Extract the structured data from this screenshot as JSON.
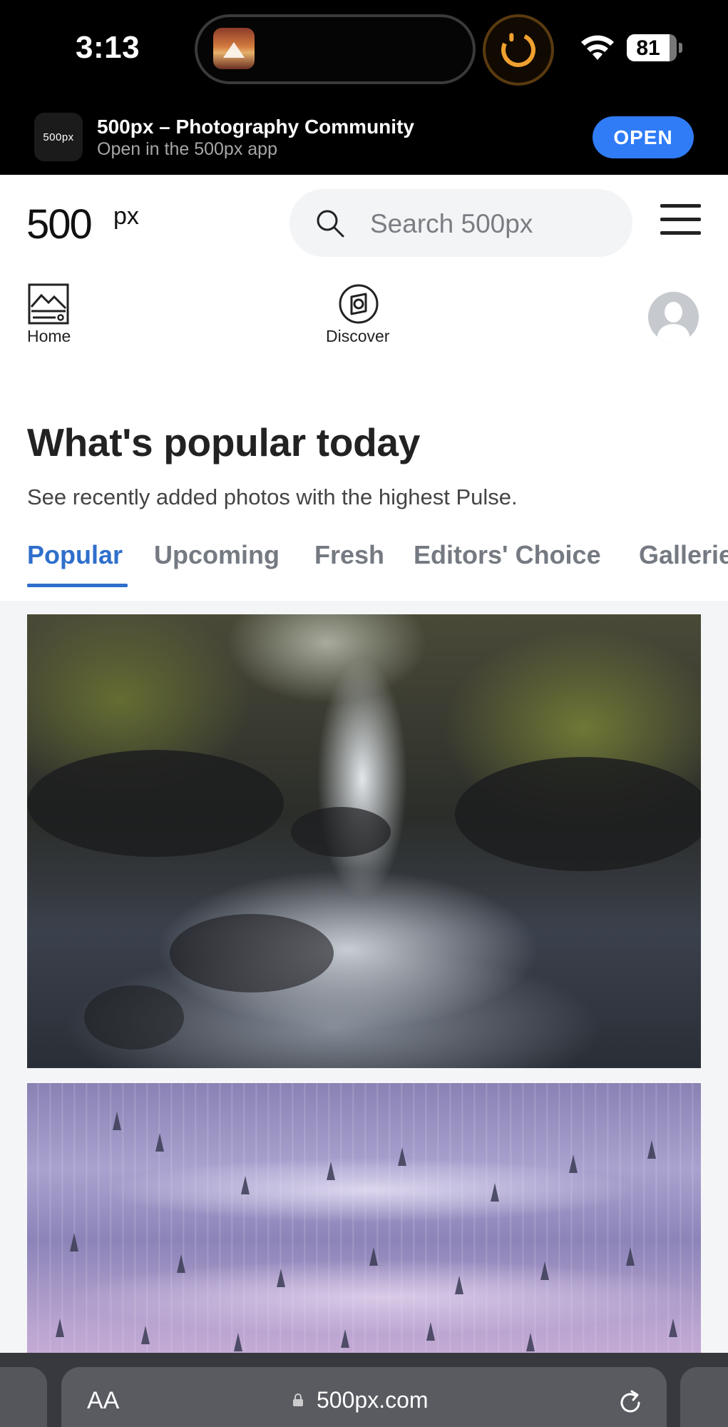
{
  "status_bar": {
    "time": "3:13",
    "battery": "81",
    "icons": [
      "album-art-icon",
      "timer-icon",
      "wifi-icon",
      "battery-icon"
    ]
  },
  "app_banner": {
    "icon_text": "500px",
    "title": "500px – Photography Community",
    "subtitle": "Open in the 500px app",
    "open_label": "OPEN"
  },
  "header": {
    "logo": "500px",
    "search_placeholder": "Search 500px",
    "icons": [
      "search-icon",
      "menu-icon"
    ]
  },
  "nav": {
    "home_label": "Home",
    "discover_label": "Discover",
    "icons": [
      "home-icon",
      "discover-icon",
      "avatar"
    ]
  },
  "main": {
    "title": "What's popular today",
    "subtitle": "See recently added photos with the highest Pulse.",
    "tabs": [
      {
        "label": "Popular",
        "active": true
      },
      {
        "label": "Upcoming",
        "active": false
      },
      {
        "label": "Fresh",
        "active": false
      },
      {
        "label": "Editors' Choice",
        "active": false
      },
      {
        "label": "Galleries",
        "active": false
      }
    ],
    "accent_color": "#2f6fcc"
  },
  "browser_bar": {
    "aa_label": "AA",
    "url": "500px.com",
    "icons": [
      "lock-icon",
      "reload-icon"
    ]
  },
  "colors": {
    "banner_bg": "#000000",
    "open_button": "#2f7cf6",
    "search_bg": "#f3f4f6",
    "feed_bg": "#f4f5f7",
    "browser_bar_bg": "#38393e"
  }
}
